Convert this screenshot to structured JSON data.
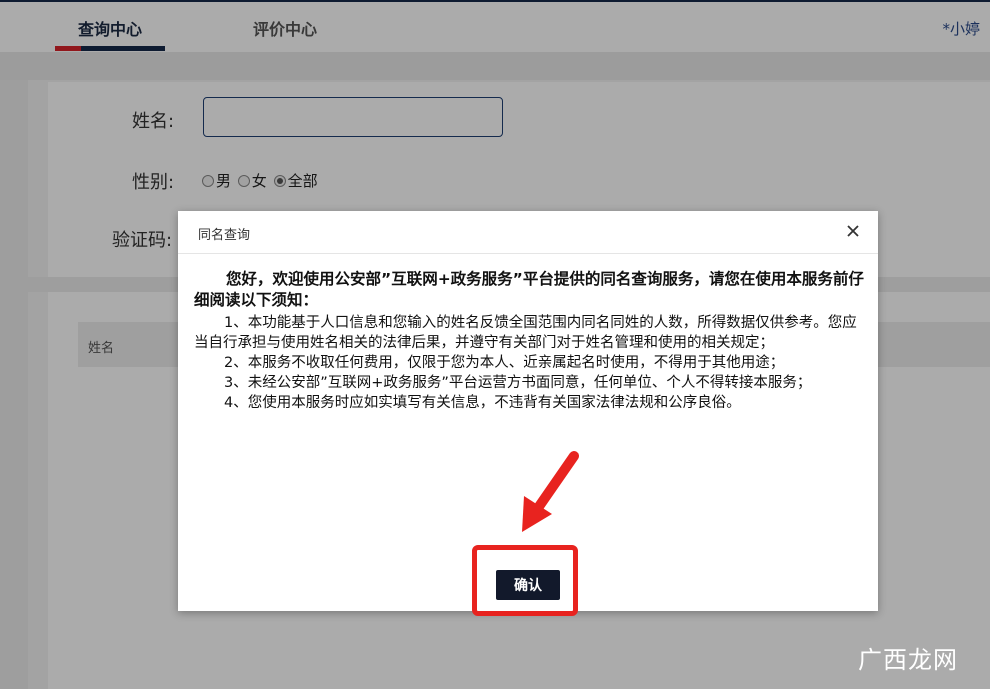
{
  "nav": {
    "tabs": [
      {
        "label": "查询中心"
      },
      {
        "label": "评价中心"
      }
    ],
    "user": "*小婷"
  },
  "form": {
    "name_label": "姓名:",
    "gender_label": "性别:",
    "gender_options": [
      {
        "label": "男",
        "selected": false
      },
      {
        "label": "女",
        "selected": false
      },
      {
        "label": "全部",
        "selected": true
      }
    ],
    "captcha_label": "验证码:"
  },
  "table": {
    "columns": [
      "姓名"
    ]
  },
  "modal": {
    "title": "同名查询",
    "intro": "您好，欢迎使用公安部”互联网+政务服务”平台提供的同名查询服务，请您在使用本服务前仔细阅读以下须知：",
    "items": [
      "1、本功能基于人口信息和您输入的姓名反馈全国范围内同名同姓的人数，所得数据仅供参考。您应当自行承担与使用姓名相关的法律后果，并遵守有关部门对于姓名管理和使用的相关规定；",
      "2、本服务不收取任何费用，仅限于您为本人、近亲属起名时使用，不得用于其他用途；",
      "3、未经公安部”互联网+政务服务”平台运营方书面同意，任何单位、个人不得转接本服务；",
      "4、您使用本服务时应如实填写有关信息，不违背有关国家法律法规和公序良俗。"
    ],
    "confirm_label": "确认"
  },
  "watermark": "广西龙网",
  "colors": {
    "brand_navy": "#16294a",
    "accent_red": "#d9232a",
    "highlight_red": "#e8231f",
    "button_dark": "#12192b"
  }
}
